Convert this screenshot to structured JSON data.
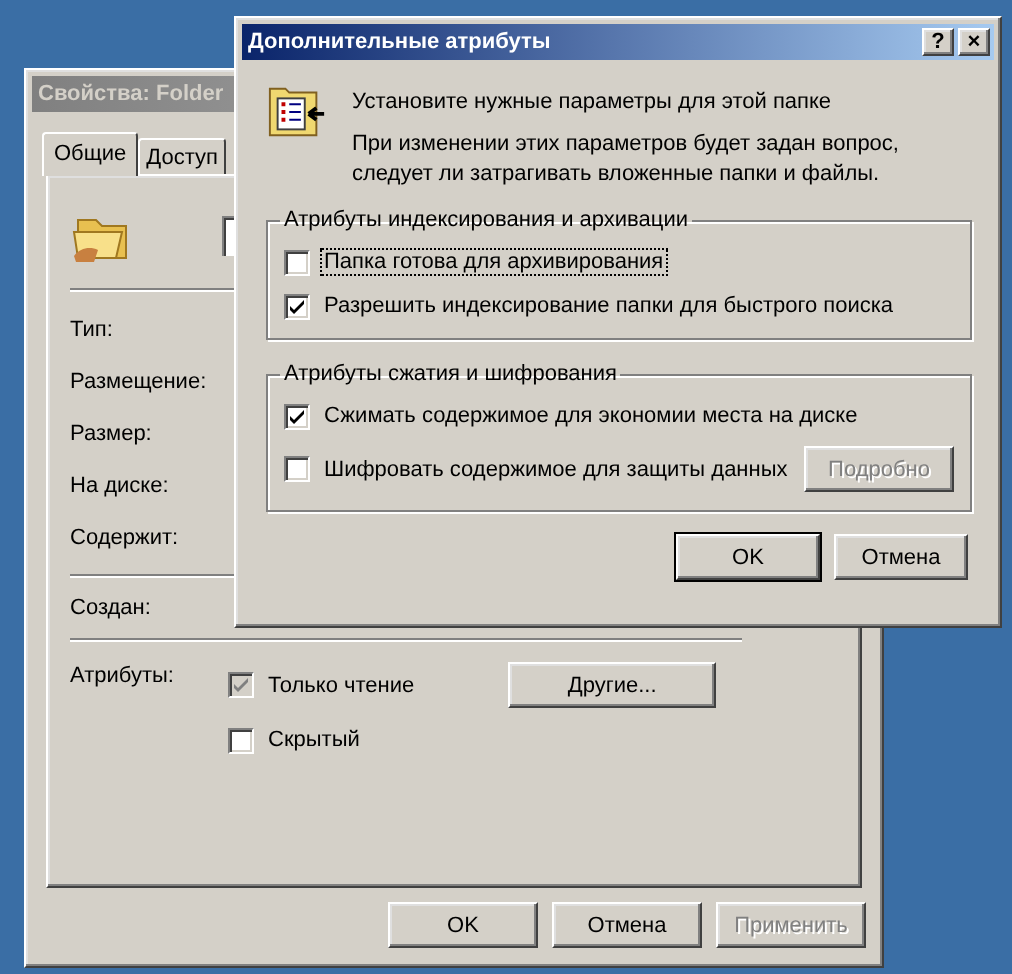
{
  "properties_window": {
    "title": "Свойства: Folder",
    "active": false,
    "tabs": [
      {
        "label": "Общие",
        "selected": true
      },
      {
        "label": "Доступ",
        "selected": false
      }
    ],
    "properties": [
      {
        "label": "Тип:"
      },
      {
        "label": "Размещение:"
      },
      {
        "label": "Размер:"
      },
      {
        "label": "На диске:"
      },
      {
        "label": "Содержит:"
      }
    ],
    "created": {
      "label": "Создан:"
    },
    "attributes": {
      "label": "Атрибуты:",
      "options": [
        {
          "label": "Только чтение",
          "checked": true,
          "disabled": true
        },
        {
          "label": "Скрытый",
          "checked": false,
          "disabled": false
        }
      ],
      "other_button": "Другие..."
    },
    "buttons": [
      {
        "label": "OK",
        "disabled": false
      },
      {
        "label": "Отмена",
        "disabled": false
      },
      {
        "label": "Применить",
        "disabled": true
      }
    ]
  },
  "attributes_dialog": {
    "title": "Дополнительные атрибуты",
    "active": true,
    "help_button": "?",
    "close_button": "×",
    "intro": "Установите нужные параметры для этой папке",
    "note": "При изменении этих параметров будет задан вопрос, следует ли затрагивать вложенные папки и файлы.",
    "groups": [
      {
        "title": "Атрибуты индексирования и архивации",
        "options": [
          {
            "label": "Папка готова для архивирования",
            "checked": false,
            "focused": true
          },
          {
            "label": "Разрешить индексирование папки для быстрого поиска",
            "checked": true,
            "focused": false
          }
        ]
      },
      {
        "title": "Атрибуты сжатия и шифрования",
        "options": [
          {
            "label": "Сжимать содержимое для экономии места на диске",
            "checked": true,
            "focused": false
          },
          {
            "label": "Шифровать содержимое для защиты данных",
            "checked": false,
            "focused": false
          }
        ],
        "details_button": {
          "label": "Подробно",
          "disabled": true
        }
      }
    ],
    "buttons": [
      {
        "label": "OK",
        "default": true
      },
      {
        "label": "Отмена",
        "default": false
      }
    ]
  }
}
